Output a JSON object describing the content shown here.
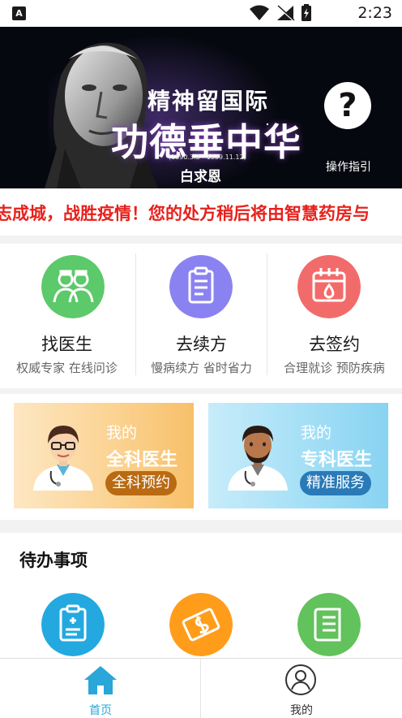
{
  "statusbar": {
    "time": "2:23",
    "notification_badge": "A"
  },
  "banner": {
    "headline_small": "精神留国际",
    "headline_large": "功德垂中华",
    "dates": "(1890.3.3—1939.11.12)",
    "name": "白求恩",
    "guide_glyph": "?",
    "guide_label": "操作指引"
  },
  "marquee": {
    "text": "志成城，战胜疫情！您的处方稍后将由智慧药房与"
  },
  "services": [
    {
      "title": "找医生",
      "subtitle": "权威专家 在线问诊",
      "icon": "doctors-icon",
      "color": "#5cc96a"
    },
    {
      "title": "去续方",
      "subtitle": "慢病续方 省时省力",
      "icon": "clipboard-icon",
      "color": "#8b82f2"
    },
    {
      "title": "去签约",
      "subtitle": "合理就诊 预防疾病",
      "icon": "calendar-icon",
      "color": "#f26b6b"
    }
  ],
  "cards": [
    {
      "my": "我的",
      "title": "全科医生",
      "button": "全科预约",
      "icon": "general-doctor-avatar"
    },
    {
      "my": "我的",
      "title": "专科医生",
      "button": "精准服务",
      "icon": "specialist-doctor-avatar"
    }
  ],
  "todo": {
    "heading": "待办事项",
    "icons": [
      {
        "icon": "medical-report-icon",
        "color": "#23a9e0"
      },
      {
        "icon": "payment-icon",
        "color": "#ff9d1b"
      },
      {
        "icon": "document-list-icon",
        "color": "#62c25c"
      }
    ]
  },
  "bottomnav": {
    "items": [
      {
        "label": "首页",
        "icon": "home-icon",
        "active": true
      },
      {
        "label": "我的",
        "icon": "user-icon",
        "active": false
      }
    ]
  },
  "colors": {
    "accent": "#2aa6d8",
    "marquee_red": "#e8211c"
  }
}
